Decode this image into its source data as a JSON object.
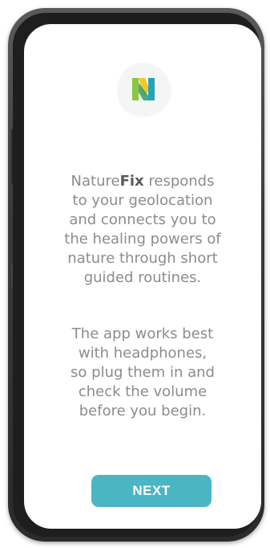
{
  "app": {
    "brand_light": "Nature",
    "brand_bold": "Fix",
    "logo_icon": "naturefix-n-logo",
    "logo_colors": {
      "left": "#8cc63f",
      "right": "#27a3b8",
      "accent": "#f6c21b"
    }
  },
  "intro": {
    "line1_suffix": " responds",
    "line2": "to your geolocation",
    "line3": "and connects you to",
    "line4": "the healing powers of",
    "line5": "nature through short",
    "line6": "guided routines."
  },
  "tips": {
    "line1": "The app works best",
    "line2": "with headphones,",
    "line3": "so plug them in and",
    "line4": "check the volume",
    "line5": "before you begin."
  },
  "actions": {
    "next_label": "NEXT",
    "next_color": "#4bb5c4"
  }
}
